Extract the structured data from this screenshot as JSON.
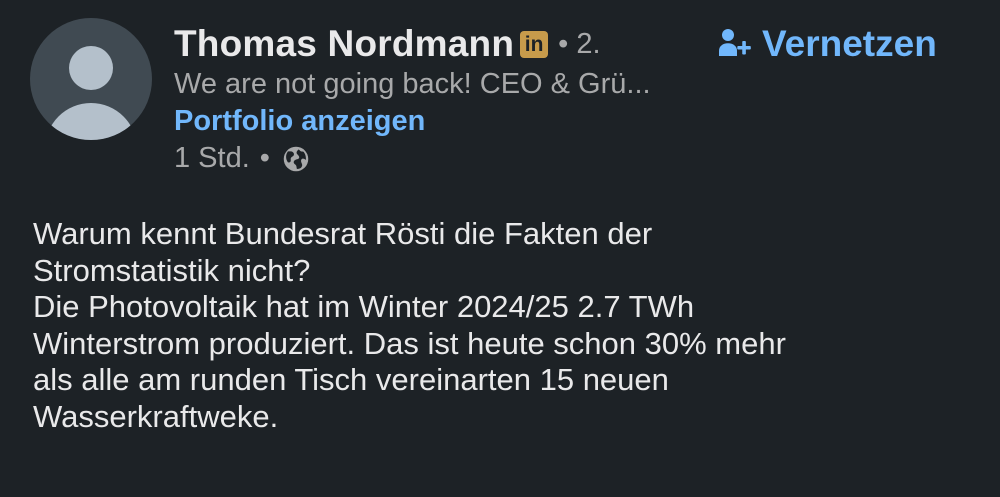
{
  "author": {
    "name": "Thomas Nordmann",
    "badge_icon": "linkedin-premium-icon",
    "badge_text": "in",
    "degree": "• 2.",
    "headline": "We are not going back! CEO & Grü...",
    "portfolio_link": "Portfolio anzeigen",
    "time": "1 Std.",
    "separator": "•",
    "visibility_icon": "globe-icon"
  },
  "actions": {
    "connect_label": "Vernetzen",
    "connect_icon": "add-person-icon"
  },
  "post": {
    "lines": [
      "Warum kennt Bundesrat Rösti die Fakten der",
      "Stromstatistik nicht?",
      "Die Photovoltaik hat im Winter 2024/25 2.7 TWh",
      "Winterstrom produziert. Das ist heute schon 30% mehr",
      "als alle am runden Tisch vereinarten 15 neuen",
      "Wasserkraftweke."
    ]
  },
  "colors": {
    "background": "#1d2226",
    "text": "#e9e9ea",
    "muted": "#a8a9aa",
    "link": "#71b7fb",
    "badge": "#c79b4b"
  }
}
